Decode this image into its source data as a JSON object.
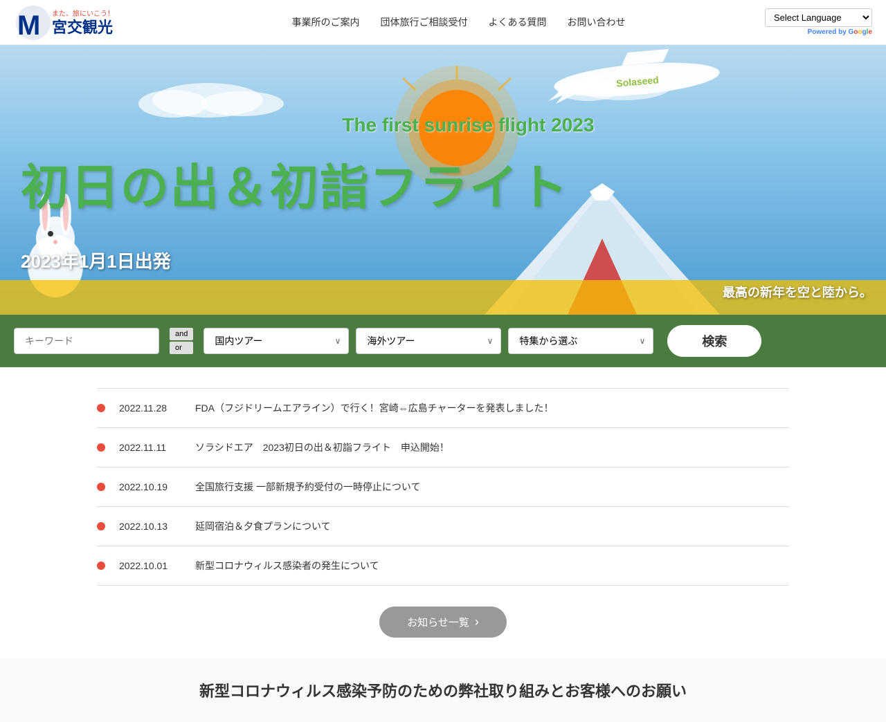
{
  "header": {
    "logo_alt": "宮交観光",
    "nav": {
      "items": [
        {
          "label": "事業所のご案内",
          "href": "#"
        },
        {
          "label": "団体旅行ご相談受付",
          "href": "#"
        },
        {
          "label": "よくある質問",
          "href": "#"
        },
        {
          "label": "お問い合わせ",
          "href": "#"
        }
      ]
    },
    "lang_select": {
      "label": "Select Language",
      "powered_by": "Powered by",
      "google": "Google"
    }
  },
  "hero": {
    "text_en": "The first sunrise flight 2023",
    "text_jp": "初日の出＆初詣フライト",
    "date": "2023年1月1日出発",
    "tagline": "最高の新年を空と陸から。"
  },
  "search": {
    "keyword_placeholder": "キーワード",
    "and_label": "and",
    "or_label": "or",
    "domestic_label": "国内ツアー",
    "overseas_label": "海外ツアー",
    "feature_label": "特集から選ぶ",
    "search_button": "検索",
    "domestic_options": [
      "国内ツアー"
    ],
    "overseas_options": [
      "海外ツアー"
    ],
    "feature_options": [
      "特集から選ぶ"
    ]
  },
  "news": {
    "items": [
      {
        "date": "2022.11.28",
        "text": "FDA（フジドリームエアライン）で行く！宮崎⇔広島チャーターを発表しました！"
      },
      {
        "date": "2022.11.11",
        "text": "ソラシドエア　2023初日の出＆初詣フライト　申込開始！"
      },
      {
        "date": "2022.10.19",
        "text": "全国旅行支援 一部新規予約受付の一時停止について"
      },
      {
        "date": "2022.10.13",
        "text": "延岡宿泊＆夕食プランについて"
      },
      {
        "date": "2022.10.01",
        "text": "新型コロナウィルス感染者の発生について"
      }
    ],
    "more_button": "お知らせ一覧"
  },
  "bottom": {
    "title": "新型コロナウィルス感染予防のための弊社取り組みとお客様へのお願い"
  }
}
